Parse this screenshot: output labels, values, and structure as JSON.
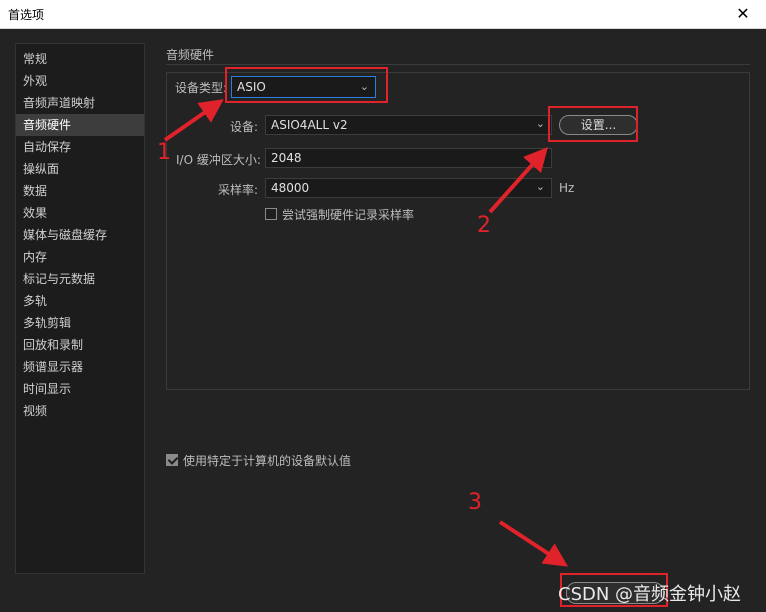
{
  "window": {
    "title": "首选项",
    "close": "✕"
  },
  "sidebar": {
    "items": [
      "常规",
      "外观",
      "音频声道映射",
      "音频硬件",
      "自动保存",
      "操纵面",
      "数据",
      "效果",
      "媒体与磁盘缓存",
      "内存",
      "标记与元数据",
      "多轨",
      "多轨剪辑",
      "回放和录制",
      "频谱显示器",
      "时间显示",
      "视频"
    ],
    "active_index": 3
  },
  "section": {
    "title": "音频硬件"
  },
  "device_type": {
    "label": "设备类型:",
    "value": "ASIO"
  },
  "device": {
    "label": "设备:",
    "value": "ASIO4ALL v2",
    "settings_button": "设置..."
  },
  "buffer": {
    "label": "I/O 缓冲区大小:",
    "value": "2048"
  },
  "sample_rate": {
    "label": "采样率:",
    "value": "48000",
    "unit": "Hz"
  },
  "force_rate": {
    "label": "尝试强制硬件记录采样率",
    "checked": false
  },
  "use_default": {
    "label": "使用特定于计算机的设备默认值",
    "checked": true
  },
  "annotations": {
    "n1": "1",
    "n2": "2",
    "n3": "3"
  },
  "watermark": "CSDN @音频金钟小赵",
  "colors": {
    "annotation": "#e0232b",
    "focus": "#2a7de1"
  }
}
